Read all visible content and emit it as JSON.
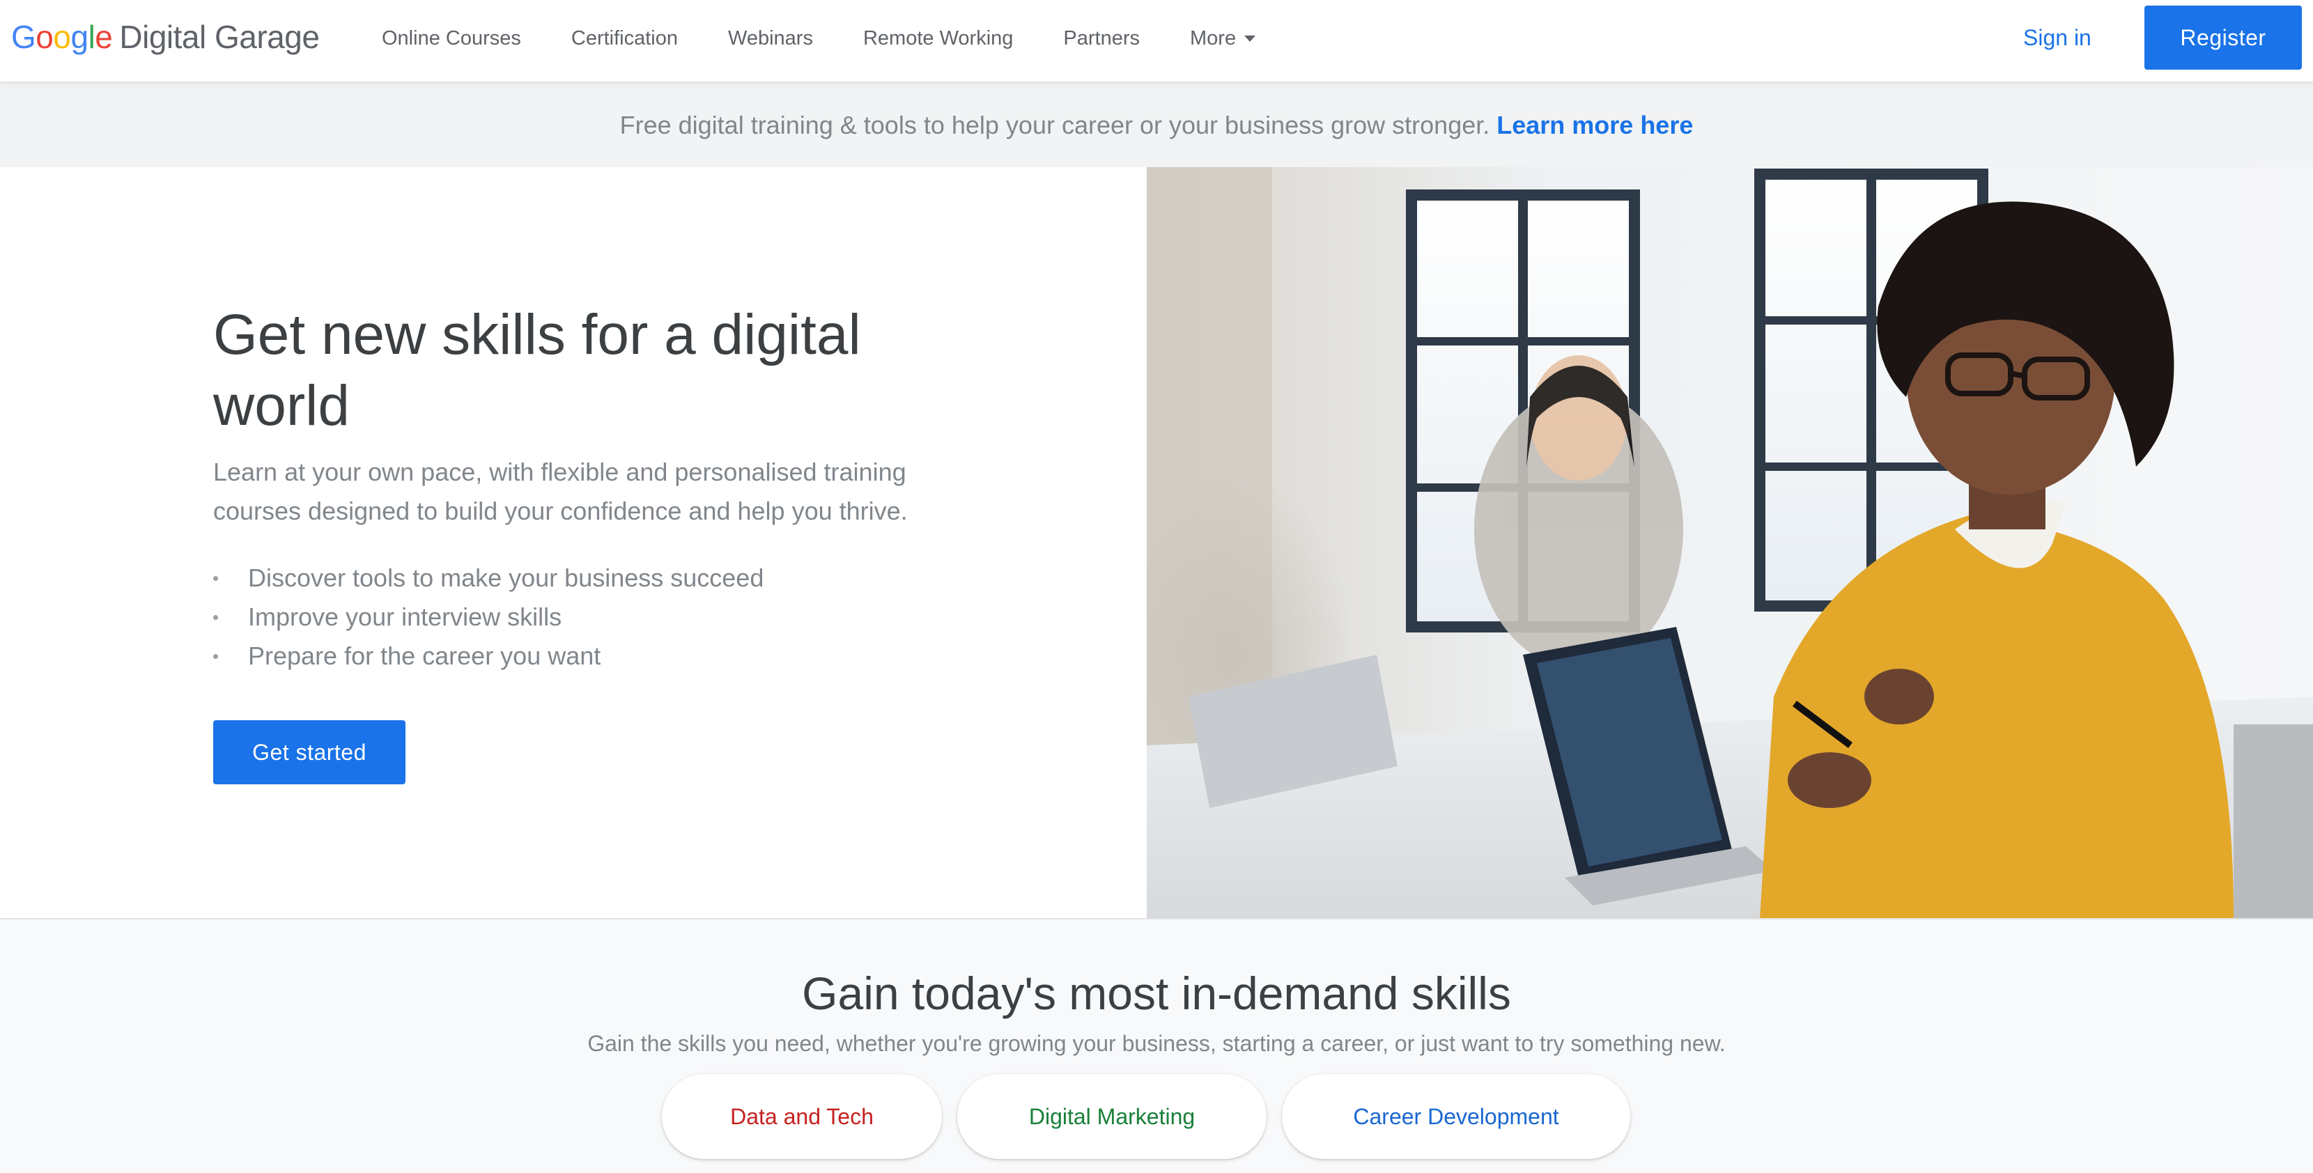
{
  "header": {
    "logo": {
      "google_letters": [
        {
          "char": "G",
          "color": "#4285F4"
        },
        {
          "char": "o",
          "color": "#EA4335"
        },
        {
          "char": "o",
          "color": "#FBBC05"
        },
        {
          "char": "g",
          "color": "#4285F4"
        },
        {
          "char": "l",
          "color": "#34A853"
        },
        {
          "char": "e",
          "color": "#EA4335"
        }
      ],
      "product": "Digital Garage"
    },
    "nav": [
      "Online Courses",
      "Certification",
      "Webinars",
      "Remote Working",
      "Partners",
      "More"
    ],
    "more_icon": "caret-down-icon",
    "sign_in": "Sign in",
    "register": "Register"
  },
  "banner": {
    "text": "Free digital training & tools to help your career or your business grow stronger.",
    "link": "Learn more here"
  },
  "hero": {
    "title": "Get new skills for a digital world",
    "subtitle": "Learn at your own pace, with flexible and personalised training courses designed to build your confidence and help you thrive.",
    "bullets": [
      "Discover tools to make your business succeed",
      "Improve your interview skills",
      "Prepare for the career you want"
    ],
    "cta": "Get started"
  },
  "skills": {
    "title": "Gain today's most in-demand skills",
    "subtitle": "Gain the skills you need, whether you're growing your business, starting a career, or just want to try something new.",
    "categories": [
      {
        "label": "Data and Tech",
        "color": "#C5221F"
      },
      {
        "label": "Digital Marketing",
        "color": "#188038"
      },
      {
        "label": "Career Development",
        "color": "#1967D2"
      }
    ]
  },
  "colors": {
    "primary": "#1A73E8",
    "text": "#3C4043",
    "muted": "#80868B",
    "banner_bg": "#F1F3F4"
  }
}
